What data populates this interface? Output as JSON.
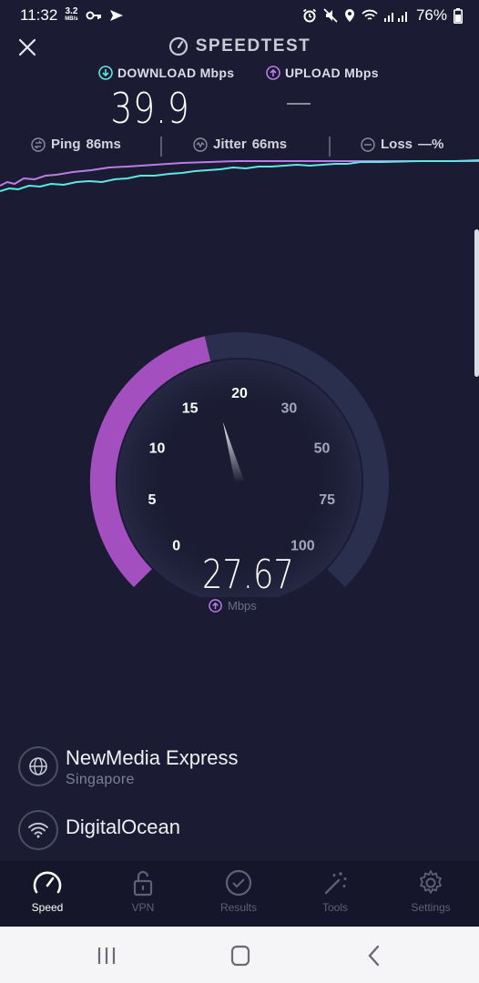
{
  "status_bar": {
    "time": "11:32",
    "net_speed": "3.2",
    "net_unit": "MB/s",
    "battery": "76%"
  },
  "header": {
    "title": "SPEEDTEST"
  },
  "metrics": {
    "download_label": "DOWNLOAD Mbps",
    "upload_label": "UPLOAD Mbps",
    "download_value": "39.9",
    "upload_value": "—"
  },
  "stats": {
    "ping_label": "Ping",
    "ping_value": "86ms",
    "jitter_label": "Jitter",
    "jitter_value": "66ms",
    "loss_label": "Loss",
    "loss_value": "—%"
  },
  "gauge": {
    "ticks": [
      "0",
      "5",
      "10",
      "15",
      "20",
      "30",
      "50",
      "75",
      "100"
    ],
    "current_speed": "27.67",
    "unit": "Mbps",
    "progress_fraction": 0.45,
    "colors": {
      "accent": "#a34fc0",
      "track": "#2a2f4d",
      "download": "#5ee6e0",
      "upload": "#b97de6"
    }
  },
  "servers": [
    {
      "name": "NewMedia Express",
      "location": "Singapore",
      "icon": "globe-icon"
    },
    {
      "name": "DigitalOcean",
      "location": "",
      "icon": "wifi-icon"
    }
  ],
  "nav": [
    {
      "label": "Speed",
      "icon": "speedometer-icon",
      "active": true
    },
    {
      "label": "VPN",
      "icon": "lock-icon",
      "active": false
    },
    {
      "label": "Results",
      "icon": "check-circle-icon",
      "active": false
    },
    {
      "label": "Tools",
      "icon": "wand-icon",
      "active": false
    },
    {
      "label": "Settings",
      "icon": "gear-icon",
      "active": false
    }
  ]
}
